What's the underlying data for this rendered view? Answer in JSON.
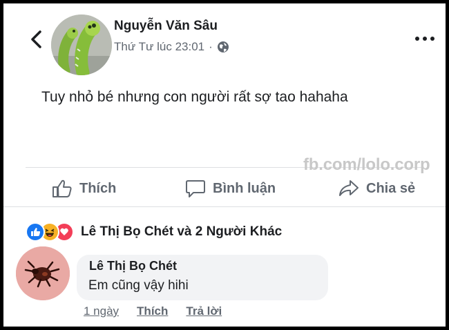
{
  "post": {
    "author": "Nguyễn Văn Sâu",
    "timestamp": "Thứ Tư lúc 23:01",
    "separator": "·",
    "privacy_icon": "globe-icon",
    "text": "Tuy nhỏ bé nhưng con người rất sợ tao hahaha",
    "watermark": "fb.com/lolo.corp"
  },
  "actions": {
    "like": "Thích",
    "comment": "Bình luận",
    "share": "Chia sẻ"
  },
  "reactions": {
    "icons": [
      "like-icon",
      "haha-icon",
      "love-icon"
    ],
    "summary": "Lê Thị Bọ Chét và 2 Người Khác"
  },
  "comment": {
    "author": "Lê Thị Bọ Chét",
    "text": "Em cũng vậy hihi",
    "time": "1 ngày",
    "like": "Thích",
    "reply": "Trả lời"
  },
  "colors": {
    "like_blue": "#1877f2",
    "haha_yellow": "#f7b125",
    "love_red": "#f33e58",
    "text_secondary": "#606770"
  }
}
